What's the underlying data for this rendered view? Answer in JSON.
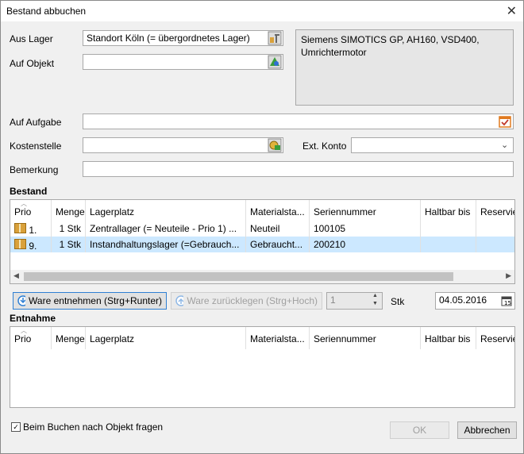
{
  "window": {
    "title": "Bestand abbuchen",
    "close_icon": "close-icon"
  },
  "form": {
    "aus_lager_label": "Aus Lager",
    "aus_lager_value": "Standort Köln (= übergordnetes Lager)",
    "auf_objekt_label": "Auf Objekt",
    "auf_objekt_value": "",
    "info_text": "Siemens SIMOTICS GP, AH160, VSD400, Umrichtermotor",
    "auf_aufgabe_label": "Auf Aufgabe",
    "auf_aufgabe_value": "",
    "kostenstelle_label": "Kostenstelle",
    "kostenstelle_value": "",
    "ext_konto_label": "Ext. Konto",
    "ext_konto_value": "",
    "bemerkung_label": "Bemerkung",
    "bemerkung_value": ""
  },
  "bestand": {
    "title": "Bestand",
    "columns": [
      "Prio",
      "Menge",
      "Lagerplatz",
      "Materialsta...",
      "Seriennummer",
      "Haltbar bis",
      "Reservie"
    ],
    "rows": [
      {
        "prio": "1.",
        "menge": "1 Stk",
        "lagerplatz": "Zentrallager (= Neuteile - Prio 1) ...",
        "material": "Neuteil",
        "serien": "100105",
        "haltbar": "",
        "reserv": ""
      },
      {
        "prio": "9.",
        "menge": "1 Stk",
        "lagerplatz": "Instandhaltungslager (=Gebrauch...",
        "material": "Gebraucht...",
        "serien": "200210",
        "haltbar": "",
        "reserv": ""
      }
    ]
  },
  "actions": {
    "entnehmen_label": "Ware entnehmen (Strg+Runter)",
    "zuruecklegen_label": "Ware zurücklegen (Strg+Hoch)",
    "quantity": "1",
    "unit": "Stk",
    "date": "04.05.2016"
  },
  "entnahme": {
    "title": "Entnahme",
    "columns": [
      "Prio",
      "Menge",
      "Lagerplatz",
      "Materialsta...",
      "Seriennummer",
      "Haltbar bis",
      "Reservie"
    ]
  },
  "footer": {
    "checkbox_label": "Beim Buchen nach Objekt fragen",
    "checkbox_checked": true,
    "ok_label": "OK",
    "cancel_label": "Abbrechen"
  },
  "colors": {
    "selection": "#cce8ff",
    "accent": "#2f7fd3"
  }
}
